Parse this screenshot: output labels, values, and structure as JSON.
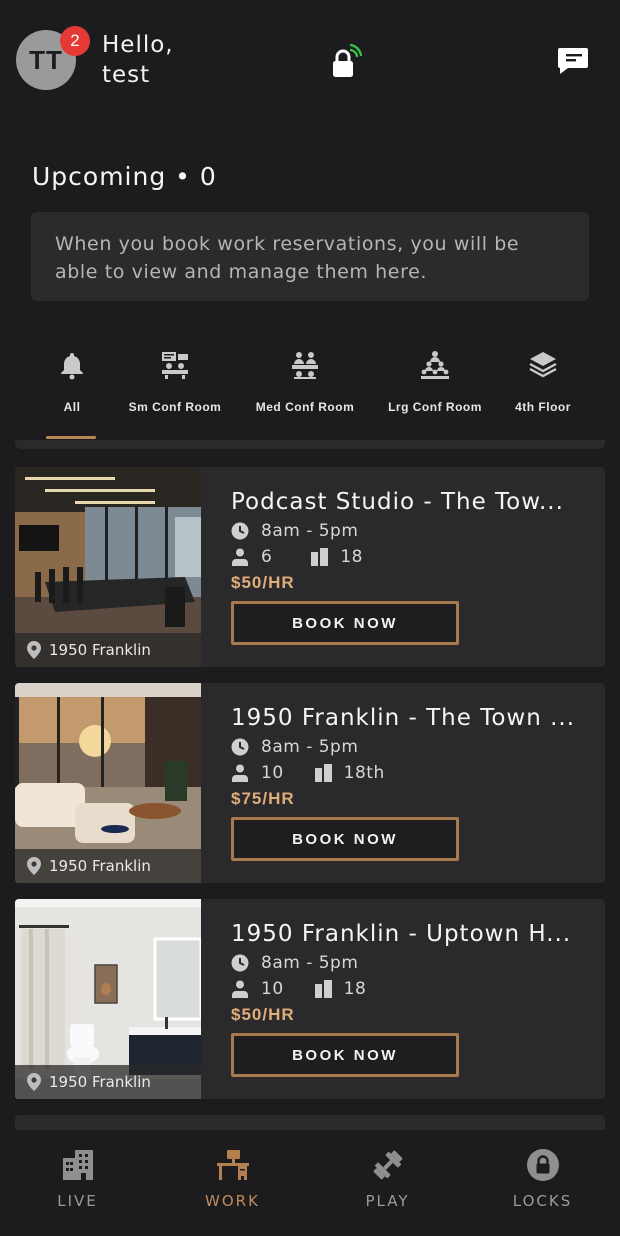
{
  "header": {
    "avatar_initials": "TT",
    "notification_count": "2",
    "greeting_line1": "Hello,",
    "greeting_line2": "test"
  },
  "upcoming": {
    "title": "Upcoming • 0",
    "empty_message": "When you book work reservations, you will be able to view and manage them here."
  },
  "filters": [
    {
      "label": "All",
      "icon": "bell-icon"
    },
    {
      "label": "Sm Conf Room",
      "icon": "small-conference-icon"
    },
    {
      "label": "Med Conf Room",
      "icon": "medium-conference-icon"
    },
    {
      "label": "Lrg Conf Room",
      "icon": "large-conference-icon"
    },
    {
      "label": "4th Floor",
      "icon": "layers-icon"
    }
  ],
  "listings": [
    {
      "title": "Podcast Studio - The Tow...",
      "hours": "8am - 5pm",
      "capacity": "6",
      "floor": "18",
      "price": "$50/HR",
      "location": "1950 Franklin",
      "button": "BOOK NOW"
    },
    {
      "title": "1950 Franklin - The Town ...",
      "hours": "8am - 5pm",
      "capacity": "10",
      "floor": "18th",
      "price": "$75/HR",
      "location": "1950 Franklin",
      "button": "BOOK NOW"
    },
    {
      "title": "1950 Franklin - Uptown H...",
      "hours": "8am - 5pm",
      "capacity": "10",
      "floor": "18",
      "price": "$50/HR",
      "location": "1950 Franklin",
      "button": "BOOK NOW"
    }
  ],
  "nav": [
    {
      "label": "LIVE",
      "icon": "building-icon",
      "active": false
    },
    {
      "label": "WORK",
      "icon": "desk-icon",
      "active": true
    },
    {
      "label": "PLAY",
      "icon": "dumbbell-icon",
      "active": false
    },
    {
      "label": "LOCKS",
      "icon": "lock-icon",
      "active": false
    }
  ],
  "colors": {
    "background": "#1c1c1e",
    "card": "#2a2a2c",
    "accent": "#c08a5a",
    "price": "#e0ad78",
    "badge": "#e53935"
  }
}
